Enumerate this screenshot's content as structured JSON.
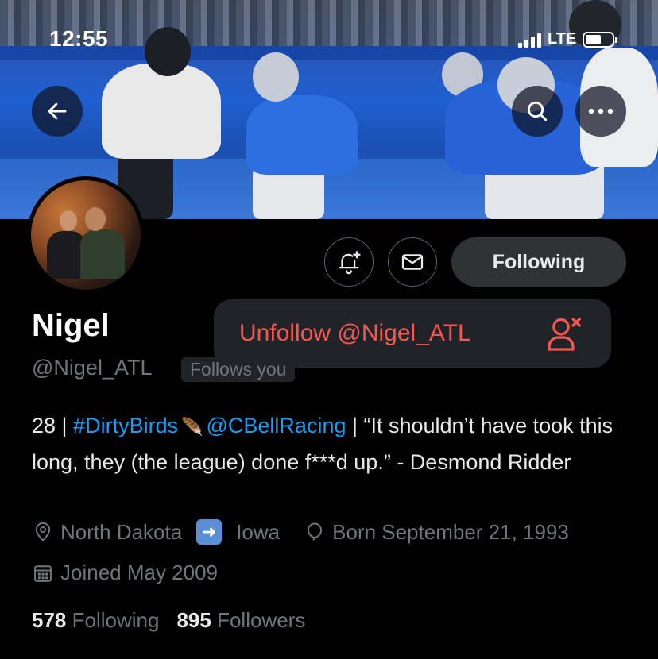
{
  "status_bar": {
    "time": "12:55",
    "network": "LTE"
  },
  "header": {
    "back_icon": "arrow-left-icon",
    "search_icon": "search-icon",
    "more_icon": "more-horizontal-icon"
  },
  "actions": {
    "notify_icon": "bell-plus-icon",
    "message_icon": "mail-icon",
    "following_label": "Following"
  },
  "popover": {
    "unfollow_label": "Unfollow @Nigel_ATL",
    "icon": "person-remove-icon",
    "accent": "#f4574f"
  },
  "profile": {
    "display_name": "Nigel",
    "handle": "@Nigel_ATL",
    "follows_you": "Follows you",
    "bio": {
      "prefix": "28 | ",
      "hashtag": "#DirtyBirds",
      "mention": "@CBellRacing",
      "suffix": " | “It shouldn’t have took this long, they (the league) done f***d up.” - Desmond Ridder"
    },
    "location_from": "North Dakota",
    "location_to": "Iowa",
    "birthday": "Born September 21, 1993",
    "joined": "Joined May 2009",
    "following_count": "578",
    "following_label": "Following",
    "followers_count": "895",
    "followers_label": "Followers"
  },
  "colors": {
    "link": "#1d9bf0",
    "muted": "#71767b",
    "background": "#000000"
  }
}
